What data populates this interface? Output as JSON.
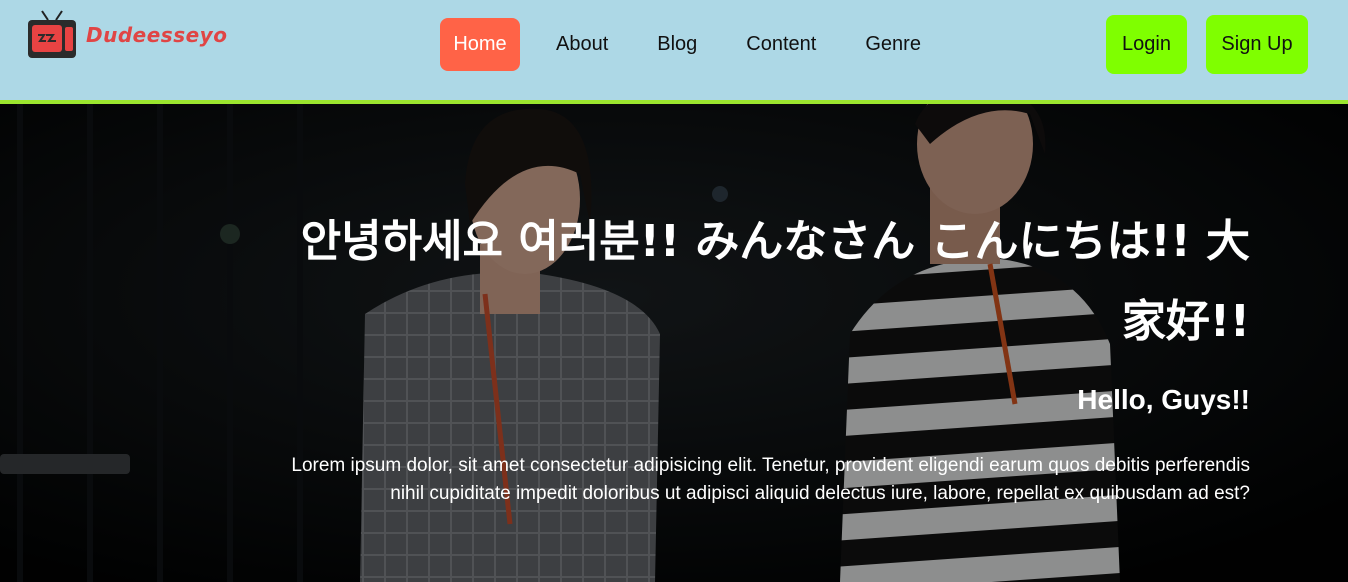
{
  "brand": {
    "name": "Dudeesseyo",
    "logo_icon": "retro-tv-icon",
    "color": "#e04545"
  },
  "nav": {
    "items": [
      {
        "label": "Home",
        "active": true
      },
      {
        "label": "About",
        "active": false
      },
      {
        "label": "Blog",
        "active": false
      },
      {
        "label": "Content",
        "active": false
      },
      {
        "label": "Genre",
        "active": false
      }
    ],
    "active_color": "#ff6347"
  },
  "auth": {
    "login_label": "Login",
    "signup_label": "Sign Up",
    "button_color": "#7fff00"
  },
  "hero": {
    "title": "안녕하세요 여러분!! みんなさん こんにちは!! 大家好!!",
    "subtitle": "Hello, Guys!!",
    "body": "Lorem ipsum dolor, sit amet consectetur adipisicing elit. Tenetur, provident eligendi earum quos debitis perferendis nihil cupiditate impedit doloribus ut adipisci aliquid delectus iure, labore, repellat ex quibusdam ad est?"
  },
  "colors": {
    "header_bg": "#add8e6",
    "header_border": "#9be52e",
    "hero_text": "#ffffff"
  }
}
